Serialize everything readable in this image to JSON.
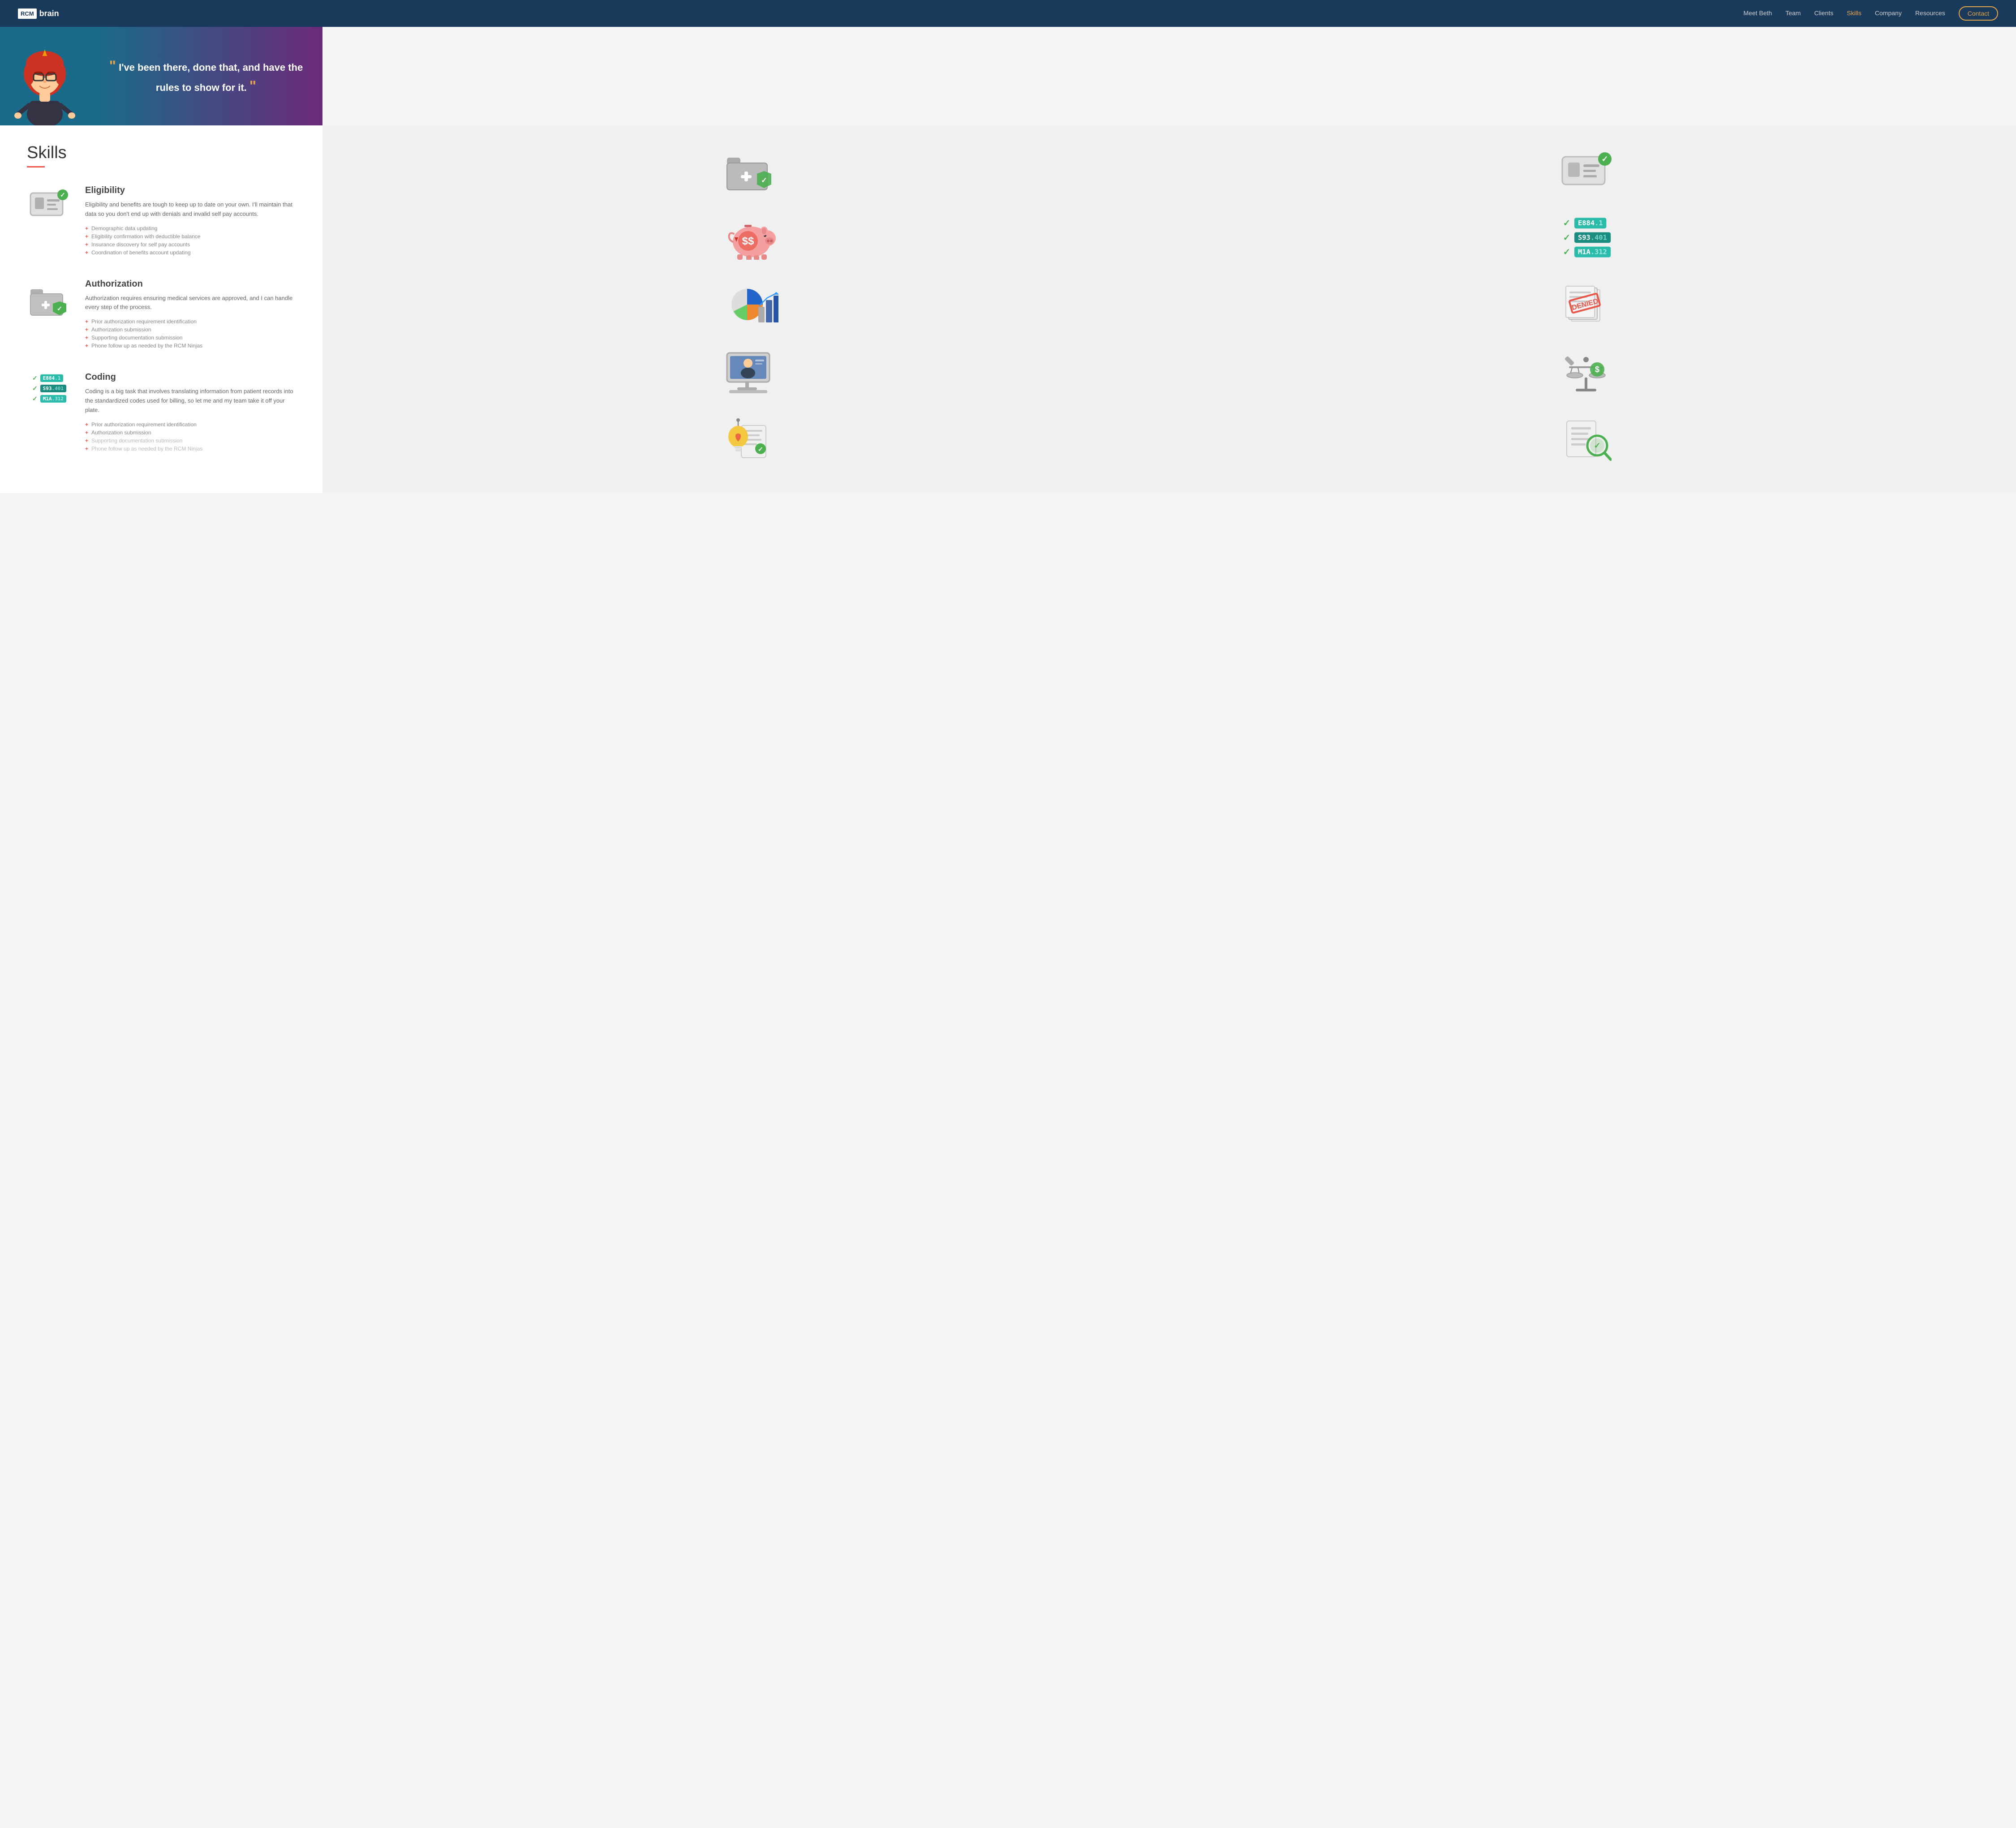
{
  "nav": {
    "logo_box": "RCM",
    "logo_text": "brain",
    "links": [
      {
        "label": "Meet Beth",
        "active": false
      },
      {
        "label": "Team",
        "active": false
      },
      {
        "label": "Clients",
        "active": false
      },
      {
        "label": "Skills",
        "active": true
      },
      {
        "label": "Company",
        "active": false
      },
      {
        "label": "Resources",
        "active": false
      }
    ],
    "contact_label": "Contact"
  },
  "hero": {
    "quote": "I've been there, done that, and have the rules to show for it."
  },
  "skills": {
    "title": "Skills",
    "items": [
      {
        "id": "eligibility",
        "title": "Eligibility",
        "description": "Eligibility and benefits are tough to keep up to date on your own. I'll maintain that data so you don't end up with denials and invalid self pay accounts.",
        "list_items": [
          "Demographic data updating",
          "Eligibility confirmation with deductible balance",
          "Insurance discovery for self pay accounts",
          "Coordination of benefits account updating"
        ]
      },
      {
        "id": "authorization",
        "title": "Authorization",
        "description": "Authorization requires ensuring medical services are approved, and I can handle every step of the process.",
        "list_items": [
          "Prior authorization requirement identification",
          "Authorization submission",
          "Supporting documentation submission",
          "Phone follow up as needed by the RCM Ninjas"
        ]
      },
      {
        "id": "coding",
        "title": "Coding",
        "description": "Coding is a big task that involves translating information from patient records into the standardized codes used for billing, so let me and my team take it off your plate.",
        "list_items": [
          "Prior authorization requirement identification",
          "Authorization submission",
          "Supporting documentation submission",
          "Phone follow up as needed by the RCM Ninjas"
        ],
        "faded": [
          2,
          3
        ]
      }
    ]
  },
  "codes": {
    "items": [
      {
        "label": "E884",
        "suffix": ".1",
        "color": "teal"
      },
      {
        "label": "S93",
        "suffix": ".401",
        "color": "dark-teal"
      },
      {
        "label": "M1A",
        "suffix": ".312",
        "color": "teal"
      }
    ]
  }
}
